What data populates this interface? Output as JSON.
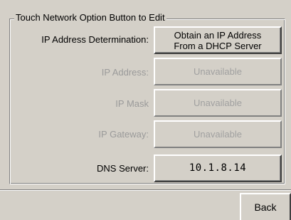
{
  "group": {
    "title": "Touch Network Option Button to Edit"
  },
  "rows": [
    {
      "label": "IP Address Determination:",
      "button": "Obtain an IP Address\nFrom a DHCP Server",
      "enabled": true
    },
    {
      "label": "IP Address:",
      "button": "Unavailable",
      "enabled": false
    },
    {
      "label": "IP Mask",
      "button": "Unavailable",
      "enabled": false
    },
    {
      "label": "IP Gateway:",
      "button": "Unavailable",
      "enabled": false
    },
    {
      "label": "DNS Server:",
      "button": "10.1.8.14",
      "enabled": true
    }
  ],
  "footer": {
    "back_label": "Back"
  },
  "colors": {
    "background": "#d4d0c8",
    "disabled_text": "#9a9a9a"
  }
}
